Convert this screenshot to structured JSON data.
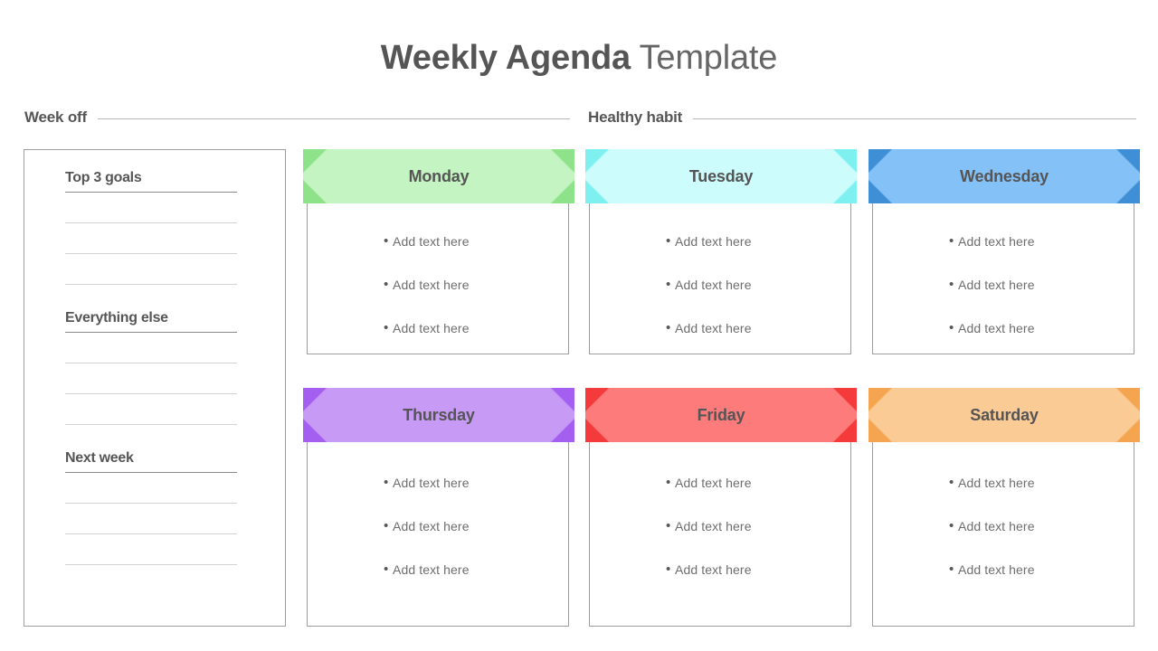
{
  "title": {
    "bold_part": "Weekly Agenda",
    "light_part": " Template"
  },
  "sections": [
    {
      "label": "Week off"
    },
    {
      "label": "Healthy habit"
    }
  ],
  "notes_panel": {
    "blocks": [
      {
        "heading": "Top 3 goals",
        "line_count": 3
      },
      {
        "heading": "Everything else",
        "line_count": 3
      },
      {
        "heading": "Next week",
        "line_count": 3
      }
    ]
  },
  "bullet_placeholder": "Add text here",
  "bullet_glyph": "•",
  "days": [
    {
      "name": "Monday",
      "column": 1,
      "row": "top",
      "header_color": "#c3f4c1",
      "fold_color": "#8de28a"
    },
    {
      "name": "Tuesday",
      "column": 2,
      "row": "top",
      "header_color": "#ccfcfc",
      "fold_color": "#7ef0f0"
    },
    {
      "name": "Wednesday",
      "column": 3,
      "row": "top",
      "header_color": "#84c1f7",
      "fold_color": "#3f8fd6"
    },
    {
      "name": "Thursday",
      "column": 1,
      "row": "bottom",
      "header_color": "#c79bf5",
      "fold_color": "#a45ef0"
    },
    {
      "name": "Friday",
      "column": 2,
      "row": "bottom",
      "header_color": "#fd7b7b",
      "fold_color": "#f43a3a"
    },
    {
      "name": "Saturday",
      "column": 3,
      "row": "bottom",
      "header_color": "#fbcb96",
      "fold_color": "#f5a44f"
    }
  ],
  "bullets_per_card": 3,
  "colors": {
    "page_background": "#ffffff",
    "title_text": "#595959",
    "heading_text": "#565656",
    "body_text": "#6e6e6e",
    "card_border": "#9e9e9e",
    "rule_strong": "#8a8a8a",
    "rule_light": "#d2d2d2",
    "section_rule": "#b9b9b9"
  }
}
